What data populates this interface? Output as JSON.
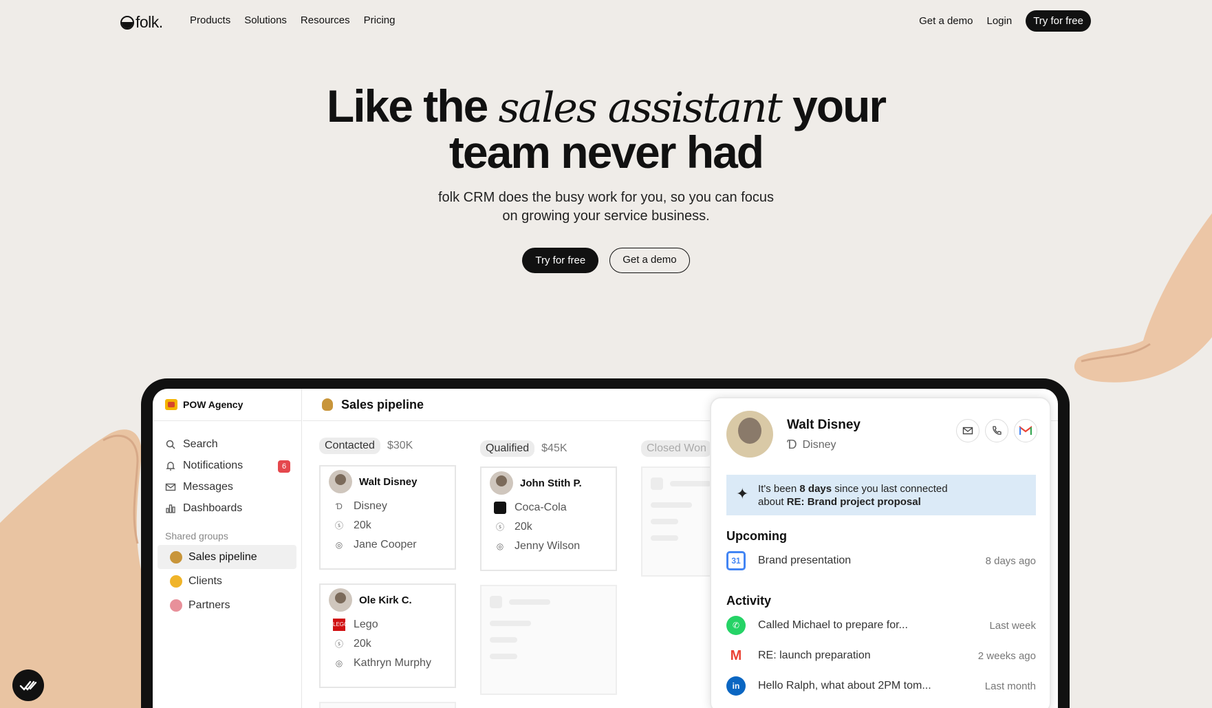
{
  "nav": {
    "logo": "folk.",
    "links": [
      "Products",
      "Solutions",
      "Resources",
      "Pricing"
    ],
    "demo": "Get a demo",
    "login": "Login",
    "try": "Try for free"
  },
  "hero": {
    "title_a": "Like the ",
    "title_em": "sales assistant",
    "title_b": " your",
    "title_c": "team never had",
    "subtitle_1": "folk CRM does the busy work for you, so you can focus",
    "subtitle_2": "on growing your service business.",
    "cta_primary": "Try for free",
    "cta_secondary": "Get a demo"
  },
  "app": {
    "workspace": "POW Agency",
    "sidebar": [
      {
        "label": "Search",
        "icon": "search-icon"
      },
      {
        "label": "Notifications",
        "icon": "bell-icon",
        "badge": "6"
      },
      {
        "label": "Messages",
        "icon": "mail-icon"
      },
      {
        "label": "Dashboards",
        "icon": "chart-icon"
      }
    ],
    "shared_groups_label": "Shared groups",
    "groups": [
      {
        "label": "Sales pipeline",
        "color": "#c8953a"
      },
      {
        "label": "Clients",
        "color": "#f0b429"
      },
      {
        "label": "Partners",
        "color": "#e8909a"
      }
    ],
    "pipeline_title": "Sales pipeline",
    "columns": [
      {
        "stage": "Contacted",
        "amount": "$30K"
      },
      {
        "stage": "Qualified",
        "amount": "$45K"
      },
      {
        "stage": "Closed Won"
      }
    ],
    "cards": [
      {
        "name": "Walt Disney",
        "company": "Disney",
        "value": "20k",
        "owner": "Jane Cooper"
      },
      {
        "name": "Ole Kirk C.",
        "company": "Lego",
        "value": "20k",
        "owner": "Kathryn Murphy"
      },
      {
        "name": "John Stith P.",
        "company": "Coca-Cola",
        "value": "20k",
        "owner": "Jenny Wilson"
      }
    ],
    "detail": {
      "name": "Walt Disney",
      "company": "Disney",
      "nudge_1": "It's been ",
      "nudge_days": "8 days",
      "nudge_2": " since you last connected",
      "nudge_3": "about ",
      "nudge_subject": "RE: Brand project proposal",
      "upcoming_label": "Upcoming",
      "upcoming": {
        "text": "Brand presentation",
        "date": "8 days ago",
        "icon": "calendar-icon"
      },
      "activity_label": "Activity",
      "activity": [
        {
          "text": "Called Michael to prepare for...",
          "date": "Last week",
          "icon": "whatsapp-icon",
          "color": "#25d366"
        },
        {
          "text": "RE: launch preparation",
          "date": "2 weeks ago",
          "icon": "gmail-icon",
          "color": "#ea4335"
        },
        {
          "text": "Hello Ralph, what about 2PM tom...",
          "date": "Last month",
          "icon": "linkedin-icon",
          "color": "#0a66c2"
        }
      ]
    }
  }
}
